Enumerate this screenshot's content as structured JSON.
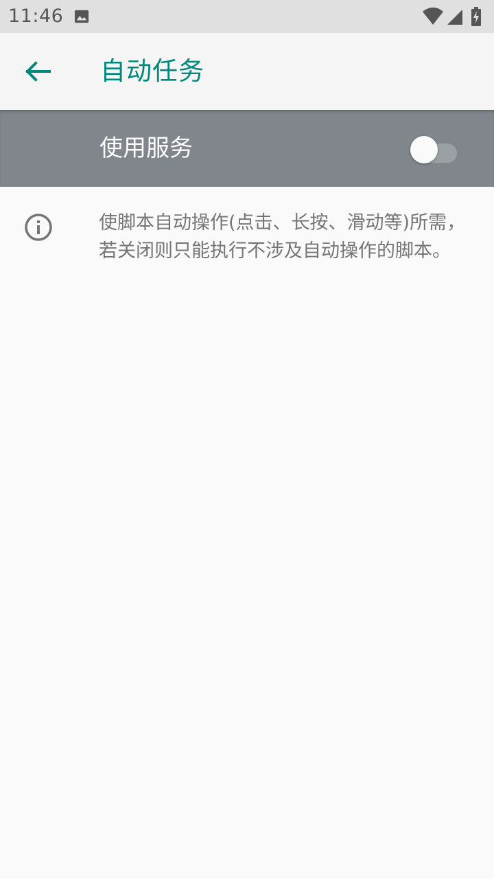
{
  "status_bar": {
    "time": "11:46",
    "icons": [
      "image-icon",
      "wifi-icon",
      "signal-icon",
      "battery-charging-icon"
    ]
  },
  "app_bar": {
    "back_icon": "arrow-back-icon",
    "title": "自动任务"
  },
  "service_switch": {
    "label": "使用服务",
    "enabled": false
  },
  "info": {
    "icon": "info-icon",
    "text": "使脚本自动操作(点击、长按、滑动等)所需，若关闭则只能执行不涉及自动操作的脚本。"
  },
  "colors": {
    "accent": "#00897b",
    "switch_bar_bg": "#80868b",
    "status_bar_bg": "#e0e0e0",
    "app_bar_bg": "#f5f5f5",
    "page_bg": "#fafafa",
    "info_text": "#757575"
  }
}
